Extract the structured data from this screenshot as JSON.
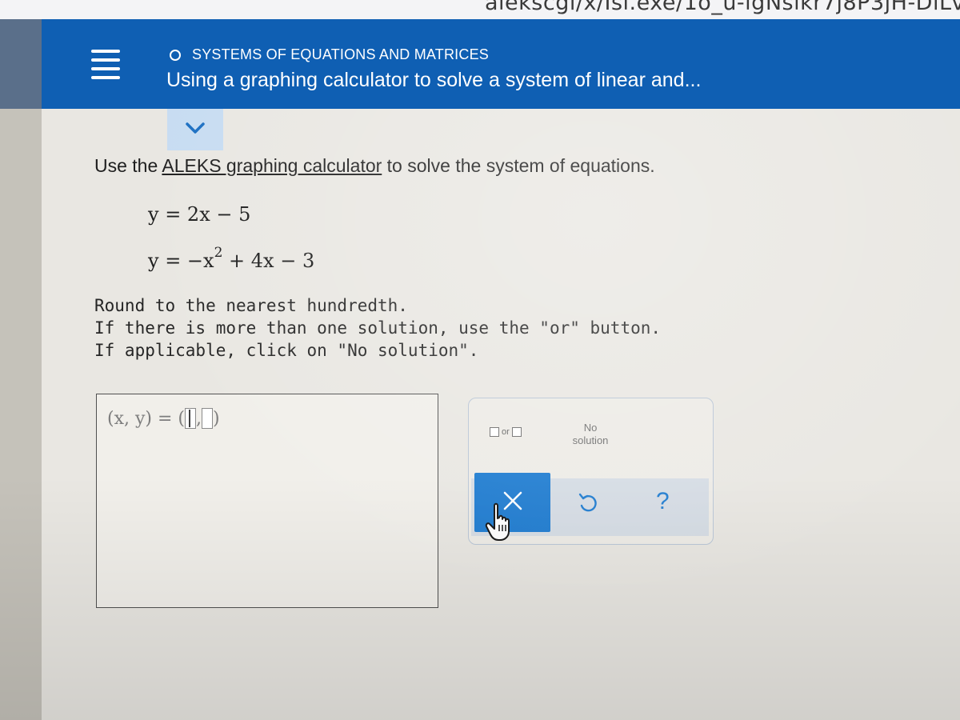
{
  "browser": {
    "url_fragment": "alekscgi/x/Isl.exe/1o_u-lgNslkr7j8P3jH-DiLv"
  },
  "header": {
    "topic": "SYSTEMS OF EQUATIONS AND MATRICES",
    "title": "Using a graphing calculator to solve a system of linear and..."
  },
  "problem": {
    "prompt_before": "Use the ",
    "prompt_link": "ALEKS graphing calculator",
    "prompt_after": " to solve the system of equations.",
    "equation_1": "y = 2x − 5",
    "equation_2_base": "y = −x",
    "equation_2_exp": "2",
    "equation_2_rest": " + 4x − 3",
    "instruction_1": "Round to the nearest hundredth.",
    "instruction_2": "If there is more than one solution, use the \"or\" button.",
    "instruction_3": "If applicable, click on \"No solution\"."
  },
  "answer": {
    "lhs": "(x, y) = (",
    "separator": ",",
    "close": ")"
  },
  "tools": {
    "or_label": "or",
    "no_solution_line1": "No",
    "no_solution_line2": "solution",
    "help_label": "?"
  },
  "colors": {
    "header_blue": "#0f5fb3",
    "button_blue": "#1d7bd0"
  },
  "icons": {
    "menu": "hamburger-icon",
    "topic": "circle-icon",
    "expand": "chevron-down-icon",
    "clear": "close-icon",
    "undo": "undo-icon",
    "help": "question-icon",
    "cursor": "hand-pointer-icon"
  }
}
